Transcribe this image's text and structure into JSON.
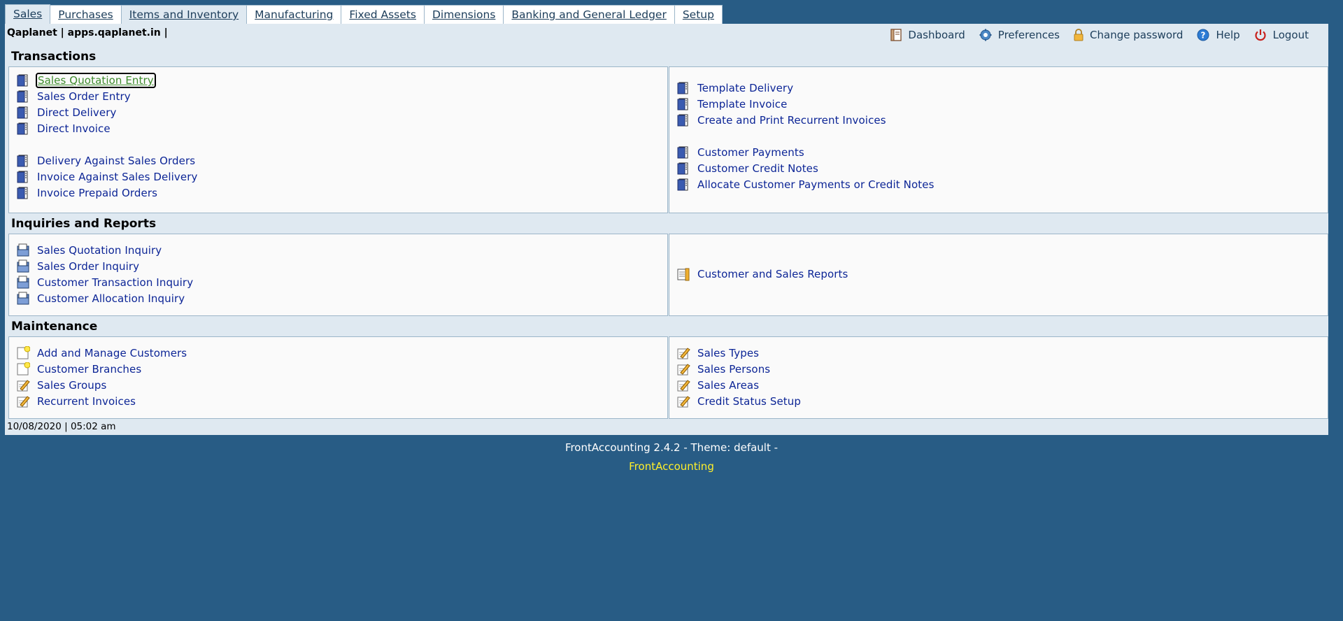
{
  "tabs": [
    {
      "label": "Sales"
    },
    {
      "label": "Purchases"
    },
    {
      "label": "Items and Inventory"
    },
    {
      "label": "Manufacturing"
    },
    {
      "label": "Fixed Assets"
    },
    {
      "label": "Dimensions"
    },
    {
      "label": "Banking and General Ledger"
    },
    {
      "label": "Setup"
    }
  ],
  "header": {
    "user_line": "Qaplanet | apps.qaplanet.in |",
    "links": {
      "dashboard": "Dashboard",
      "preferences": "Preferences",
      "change_password": "Change password",
      "help": "Help",
      "logout": "Logout"
    }
  },
  "sections": {
    "transactions": "Transactions",
    "inquiries": "Inquiries and Reports",
    "maintenance": "Maintenance"
  },
  "transactions": {
    "left": [
      {
        "label": "Sales Quotation Entry"
      },
      {
        "label": "Sales Order Entry"
      },
      {
        "label": "Direct Delivery"
      },
      {
        "label": "Direct Invoice"
      },
      {
        "label": "Delivery Against Sales Orders"
      },
      {
        "label": "Invoice Against Sales Delivery"
      },
      {
        "label": "Invoice Prepaid Orders"
      }
    ],
    "right": [
      {
        "label": "Template Delivery"
      },
      {
        "label": "Template Invoice"
      },
      {
        "label": "Create and Print Recurrent Invoices"
      },
      {
        "label": "Customer Payments"
      },
      {
        "label": "Customer Credit Notes"
      },
      {
        "label": "Allocate Customer Payments or Credit Notes"
      }
    ]
  },
  "inquiries": {
    "left": [
      {
        "label": "Sales Quotation Inquiry"
      },
      {
        "label": "Sales Order Inquiry"
      },
      {
        "label": "Customer Transaction Inquiry"
      },
      {
        "label": "Customer Allocation Inquiry"
      }
    ],
    "right": [
      {
        "label": "Customer and Sales Reports"
      }
    ]
  },
  "maintenance": {
    "left": [
      {
        "label": "Add and Manage Customers"
      },
      {
        "label": "Customer Branches"
      },
      {
        "label": "Sales Groups"
      },
      {
        "label": "Recurrent Invoices"
      }
    ],
    "right": [
      {
        "label": "Sales Types"
      },
      {
        "label": "Sales Persons"
      },
      {
        "label": "Sales Areas"
      },
      {
        "label": "Credit Status Setup"
      }
    ]
  },
  "status": {
    "datetime": "10/08/2020 | 05:02 am"
  },
  "footer": {
    "version": "FrontAccounting 2.4.2 - Theme: default -",
    "link": "FrontAccounting"
  },
  "colors": {
    "background": "#285c85",
    "link": "#0c2596",
    "focused_link": "#3d8b2b",
    "footer_link": "#ffef2a"
  }
}
